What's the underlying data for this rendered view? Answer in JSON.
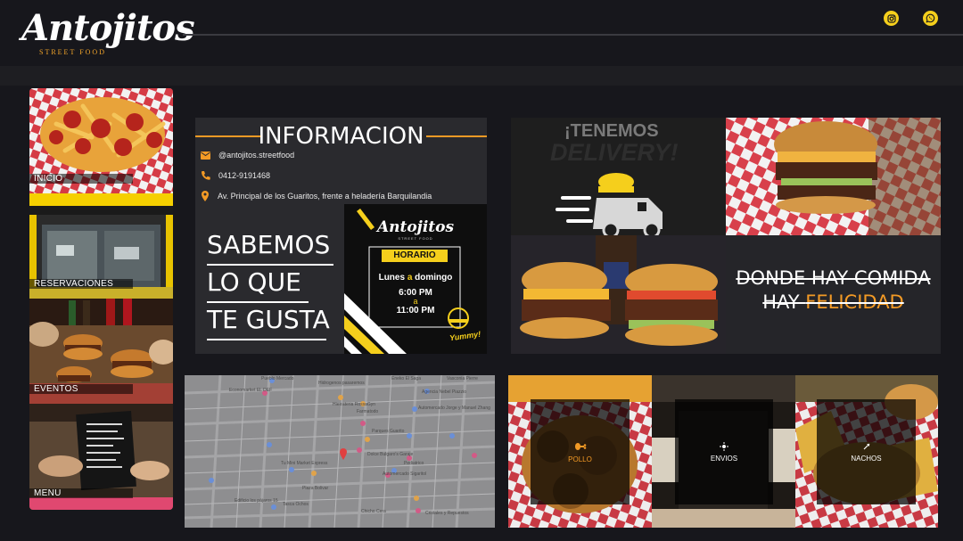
{
  "brand": {
    "name": "Antojitos",
    "sub": "STREET FOOD"
  },
  "header": {
    "icons": [
      "instagram-icon",
      "whatsapp-icon"
    ]
  },
  "sidebar": {
    "items": [
      {
        "label": "INICIO"
      },
      {
        "label": "RESERVACIONES"
      },
      {
        "label": "EVENTOS"
      },
      {
        "label": "MENU"
      }
    ]
  },
  "info": {
    "title": "INFORMACION",
    "instagram": "@antojitos.streetfood",
    "phone": "0412-9191468",
    "address": "Av. Principal de los Guaritos, frente a heladería Barquilandia",
    "slogan": [
      "SABEMOS",
      "LO QUE",
      "TE GUSTA"
    ]
  },
  "horario": {
    "brand": "Antojitos",
    "sub": "STREET FOOD",
    "title": "HORARIO",
    "days_pre": "Lunes ",
    "days_a": "a",
    "days_post": " domingo",
    "open": "6:00 PM",
    "sep": "a",
    "close": "11:00 PM",
    "yummy": "Yummy!"
  },
  "delivery": {
    "line1": "¡TENEMOS",
    "line2": "DELIVERY!"
  },
  "motto": {
    "line1": "DONDE HAY COMIDA",
    "line2_pre": "HAY ",
    "line2_accent": "FELICIDAD"
  },
  "map": {
    "labels": [
      "Pueblo Mercado",
      "Hidrogenos pasaremos",
      "Eneko El Saga",
      "Vasconia Pierre",
      "Hierrateria RossaGyn",
      "Agencia Nebel Piazzio",
      "Farmatodo",
      "Automercado Jorge y Manuel Zhang",
      "Economarket EL DEF",
      "Parques Guarito",
      "Plaza Bolivar",
      "Tu Mini Market Express",
      "Dolce Bulgaro's Garaje",
      "Pediatrico",
      "Edificio los pájaros 15",
      "Automercado Sigaritol",
      "Chicho Cera",
      "Tasca Ochos",
      "Cristales y Repuestos"
    ]
  },
  "products": [
    {
      "label": "POLLO",
      "icon": "chicken-icon"
    },
    {
      "label": "ENVIOS",
      "icon": "delivery-icon"
    },
    {
      "label": "NACHOS",
      "icon": "nachos-icon"
    }
  ],
  "colors": {
    "accent": "#f39a25",
    "yellow": "#f5cf1c",
    "bg": "#17171c",
    "panel": "#2a2a2e"
  }
}
